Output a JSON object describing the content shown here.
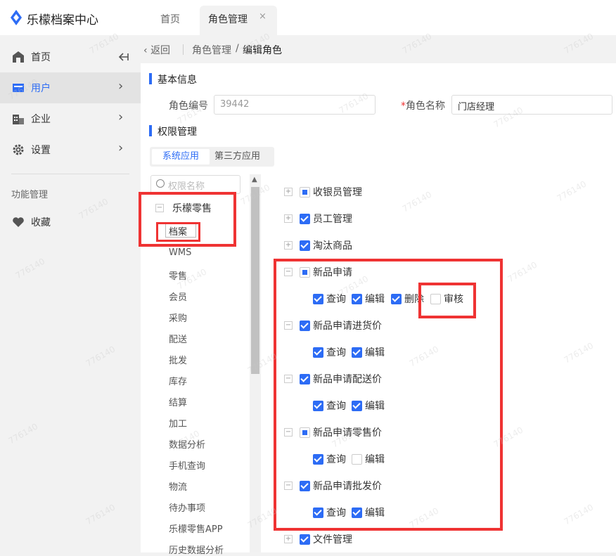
{
  "header": {
    "app_title": "乐檬档案中心",
    "tabs": [
      {
        "label": "首页"
      },
      {
        "label": "角色管理",
        "active": true
      }
    ],
    "close_glyph": "×"
  },
  "sidebar": {
    "items": [
      {
        "label": "首页",
        "icon": "home-icon"
      },
      {
        "label": "用户",
        "icon": "user-card-icon",
        "active": true
      },
      {
        "label": "企业",
        "icon": "building-icon"
      },
      {
        "label": "设置",
        "icon": "gear-icon"
      }
    ],
    "section_title": "功能管理",
    "favorites": {
      "label": "收藏",
      "icon": "heart-icon"
    }
  },
  "breadcrumb": {
    "back": "返回",
    "parent": "角色管理",
    "separator": "/",
    "current": "编辑角色"
  },
  "basic": {
    "title": "基本信息",
    "role_code_label": "角色编号",
    "role_code_value": "39442",
    "role_name_label": "角色名称",
    "required_mark": "*",
    "role_name_value": "门店经理"
  },
  "permission": {
    "title": "权限管理",
    "tabs": {
      "system": "系统应用",
      "third_party": "第三方应用"
    },
    "search_placeholder": "权限名称"
  },
  "tree": {
    "root": "乐檬零售",
    "selected": "档案",
    "items": [
      "WMS",
      "零售",
      "会员",
      "采购",
      "配送",
      "批发",
      "库存",
      "结算",
      "加工",
      "数据分析",
      "手机查询",
      "物流",
      "待办事项",
      "乐檬零售APP",
      "历史数据分析"
    ]
  },
  "perms": [
    {
      "label": "收银员管理",
      "state": "partial",
      "expander": "+"
    },
    {
      "label": "员工管理",
      "state": "checked",
      "expander": "+"
    },
    {
      "label": "淘汰商品",
      "state": "checked",
      "expander": "+"
    },
    {
      "label": "新品申请",
      "state": "partial",
      "expander": "−",
      "children": [
        {
          "label": "查询",
          "state": "checked"
        },
        {
          "label": "编辑",
          "state": "checked"
        },
        {
          "label": "删除",
          "state": "checked"
        },
        {
          "label": "审核",
          "state": "empty"
        }
      ]
    },
    {
      "label": "新品申请进货价",
      "state": "checked",
      "expander": "−",
      "children": [
        {
          "label": "查询",
          "state": "checked"
        },
        {
          "label": "编辑",
          "state": "checked"
        }
      ]
    },
    {
      "label": "新品申请配送价",
      "state": "checked",
      "expander": "−",
      "children": [
        {
          "label": "查询",
          "state": "checked"
        },
        {
          "label": "编辑",
          "state": "checked"
        }
      ]
    },
    {
      "label": "新品申请零售价",
      "state": "partial",
      "expander": "−",
      "children": [
        {
          "label": "查询",
          "state": "checked"
        },
        {
          "label": "编辑",
          "state": "empty"
        }
      ]
    },
    {
      "label": "新品申请批发价",
      "state": "checked",
      "expander": "−",
      "children": [
        {
          "label": "查询",
          "state": "checked"
        },
        {
          "label": "编辑",
          "state": "checked"
        }
      ]
    },
    {
      "label": "文件管理",
      "state": "checked",
      "expander": "+"
    }
  ],
  "watermark": "776140",
  "colors": {
    "accent": "#2d6cf5",
    "highlight": "#ef3333"
  }
}
